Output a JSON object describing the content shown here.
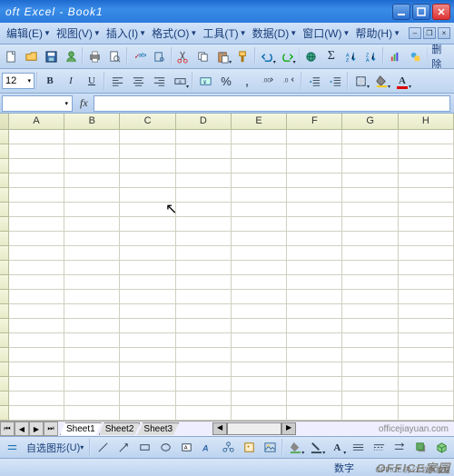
{
  "title": "oft Excel - Book1",
  "menu": [
    "编辑(E)",
    "视图(V)",
    "插入(I)",
    "格式(O)",
    "工具(T)",
    "数据(D)",
    "窗口(W)",
    "帮助(H)"
  ],
  "toolbar1": {
    "fontsize": "12",
    "sigma": "Σ",
    "delete": "删除"
  },
  "format": {
    "bold": "B",
    "italic": "I",
    "underline": "U",
    "fontcolor": "A"
  },
  "formula": {
    "namebox": "",
    "fx": "fx"
  },
  "columns": [
    "A",
    "B",
    "C",
    "D",
    "E",
    "F",
    "G",
    "H"
  ],
  "tabs": {
    "items": [
      "Sheet1",
      "Sheet2",
      "Sheet3"
    ],
    "active": 0
  },
  "draw": {
    "menu": "自选图形",
    "und": "U"
  },
  "status": {
    "right": "数字"
  },
  "watermark": {
    "url": "officejiayuan.com",
    "big": "OFFICE家园",
    "small": "OFFICE·办公·软件教程"
  }
}
